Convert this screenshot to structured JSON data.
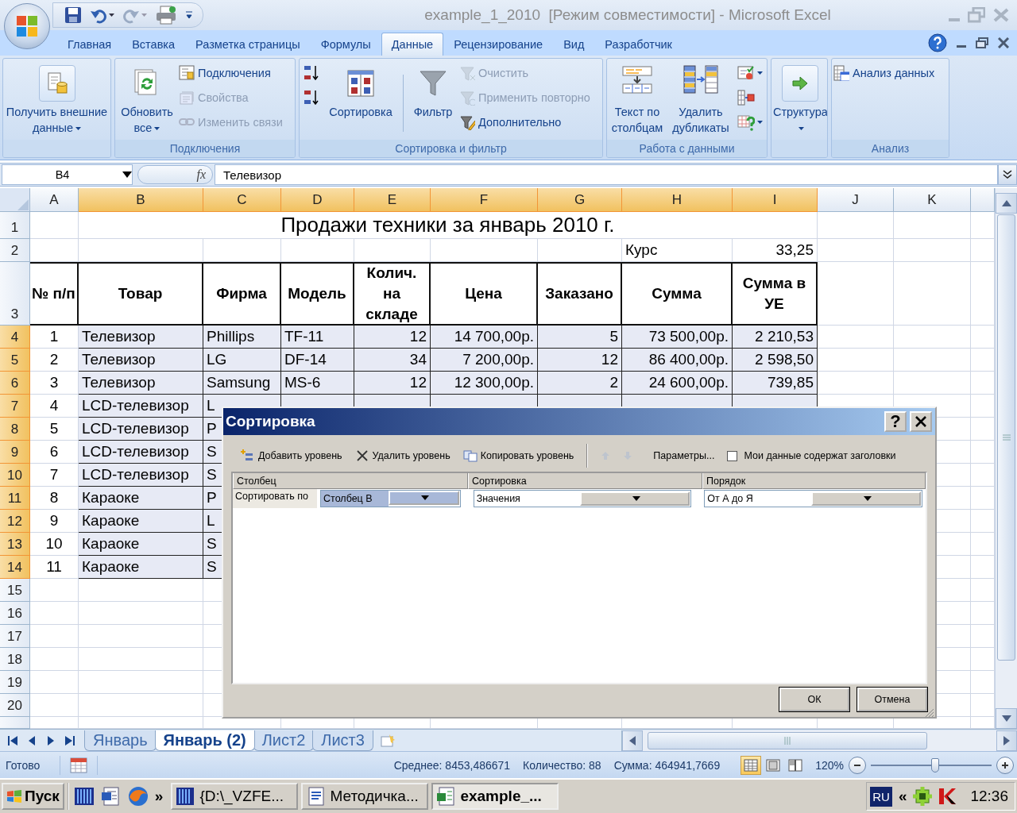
{
  "title_bar": {
    "title": "example_1_2010  [Режим совместимости] - Microsoft Excel"
  },
  "ribbon_tabs": [
    {
      "label": "Главная",
      "selected": false
    },
    {
      "label": "Вставка",
      "selected": false
    },
    {
      "label": "Разметка страницы",
      "selected": false
    },
    {
      "label": "Формулы",
      "selected": false
    },
    {
      "label": "Данные",
      "selected": true
    },
    {
      "label": "Рецензирование",
      "selected": false
    },
    {
      "label": "Вид",
      "selected": false
    },
    {
      "label": "Разработчик",
      "selected": false
    }
  ],
  "ribbon_groups": [
    {
      "items": [
        {
          "kind": "large",
          "label": "Получить внешние данные",
          "dropdown": true,
          "disabled": false
        }
      ]
    },
    {
      "label": "Подключения",
      "items": [
        {
          "kind": "large",
          "label": "Обновить все",
          "dropdown": true,
          "disabled": false
        },
        {
          "kind": "small",
          "label": "Подключения",
          "dropdown": false,
          "disabled": false
        },
        {
          "kind": "small",
          "label": "Свойства",
          "dropdown": false,
          "disabled": true
        },
        {
          "kind": "small",
          "label": "Изменить связи",
          "dropdown": false,
          "disabled": true
        }
      ]
    },
    {
      "label": "Сортировка и фильтр",
      "items": [
        {
          "kind": "icon",
          "dropdown": false,
          "disabled": false
        },
        {
          "kind": "icon",
          "dropdown": false,
          "disabled": false
        },
        {
          "kind": "large",
          "label": "Сортировка",
          "dropdown": false,
          "disabled": false
        },
        {
          "kind": "large",
          "label": "Фильтр",
          "dropdown": false,
          "disabled": false
        },
        {
          "kind": "small",
          "label": "Очистить",
          "dropdown": false,
          "disabled": true
        },
        {
          "kind": "small",
          "label": "Применить повторно",
          "dropdown": false,
          "disabled": true
        },
        {
          "kind": "small",
          "label": "Дополнительно",
          "dropdown": false,
          "disabled": false
        }
      ]
    },
    {
      "label": "Работа с данными",
      "items": [
        {
          "kind": "large",
          "label": "Текст по столбцам",
          "dropdown": false,
          "disabled": false
        },
        {
          "kind": "large",
          "label": "Удалить дубликаты",
          "dropdown": false,
          "disabled": false
        },
        {
          "kind": "icon",
          "dropdown": true,
          "disabled": false
        },
        {
          "kind": "icon",
          "dropdown": false,
          "disabled": false
        },
        {
          "kind": "icon",
          "dropdown": true,
          "disabled": false
        }
      ]
    },
    {
      "items": [
        {
          "kind": "large",
          "label": "Структура",
          "dropdown": true,
          "disabled": false
        }
      ]
    },
    {
      "label": "Анализ",
      "items": [
        {
          "kind": "small",
          "label": "Анализ данных",
          "dropdown": false,
          "disabled": false
        }
      ]
    }
  ],
  "formula_bar": {
    "name_box": "B4",
    "fx_label": "fx",
    "value": "Телевизор"
  },
  "sheet": {
    "columns": [
      {
        "label": "A",
        "selected": false
      },
      {
        "label": "B",
        "selected": true
      },
      {
        "label": "C",
        "selected": true
      },
      {
        "label": "D",
        "selected": true
      },
      {
        "label": "E",
        "selected": true
      },
      {
        "label": "F",
        "selected": true
      },
      {
        "label": "G",
        "selected": true
      },
      {
        "label": "H",
        "selected": true
      },
      {
        "label": "I",
        "selected": true
      },
      {
        "label": "J",
        "selected": false
      },
      {
        "label": "K",
        "selected": false
      }
    ],
    "row_headers": [
      {
        "label": "1",
        "selected": false
      },
      {
        "label": "2",
        "selected": false
      },
      {
        "label": "3",
        "selected": false
      },
      {
        "label": "4",
        "selected": true
      },
      {
        "label": "5",
        "selected": true
      },
      {
        "label": "6",
        "selected": true
      },
      {
        "label": "7",
        "selected": true
      },
      {
        "label": "8",
        "selected": true
      },
      {
        "label": "9",
        "selected": true
      },
      {
        "label": "10",
        "selected": true
      },
      {
        "label": "11",
        "selected": true
      },
      {
        "label": "12",
        "selected": true
      },
      {
        "label": "13",
        "selected": true
      },
      {
        "label": "14",
        "selected": true
      },
      {
        "label": "15",
        "selected": false
      },
      {
        "label": "16",
        "selected": false
      },
      {
        "label": "17",
        "selected": false
      },
      {
        "label": "18",
        "selected": false
      },
      {
        "label": "19",
        "selected": false
      },
      {
        "label": "20",
        "selected": false
      }
    ],
    "title": "Продажи техники за январь 2010 г.",
    "rate": {
      "label": "Курс",
      "value": "33,25"
    },
    "headers": [
      "№ п/п",
      "Товар",
      "Фирма",
      "Модель",
      "Колич. на складе",
      "Цена",
      "Заказано",
      "Сумма",
      "Сумма в УЕ"
    ],
    "records": [
      [
        "1",
        "Телевизор",
        "Phillips",
        "TF-11",
        "12",
        "14 700,00р.",
        "5",
        "73 500,00р.",
        "2 210,53"
      ],
      [
        "2",
        "Телевизор",
        "LG",
        "DF-14",
        "34",
        "7 200,00р.",
        "12",
        "86 400,00р.",
        "2 598,50"
      ],
      [
        "3",
        "Телевизор",
        "Samsung",
        "MS-6",
        "12",
        "12 300,00р.",
        "2",
        "24 600,00р.",
        "739,85"
      ],
      [
        "4",
        "LCD-телевизор",
        "L"
      ],
      [
        "5",
        "LCD-телевизор",
        "P"
      ],
      [
        "6",
        "LCD-телевизор",
        "S"
      ],
      [
        "7",
        "LCD-телевизор",
        "S"
      ],
      [
        "8",
        "Караоке",
        "P"
      ],
      [
        "9",
        "Караоке",
        "L"
      ],
      [
        "10",
        "Караоке",
        "S"
      ],
      [
        "11",
        "Караоке",
        "S"
      ]
    ]
  },
  "sheet_tabs": [
    {
      "label": "Январь",
      "selected": false
    },
    {
      "label": "Январь (2)",
      "selected": true
    },
    {
      "label": "Лист2",
      "selected": false
    },
    {
      "label": "Лист3",
      "selected": false
    }
  ],
  "status_bar": {
    "status": "Готово",
    "average": "Среднее: 8453,486671",
    "count": "Количество: 88",
    "sum": "Сумма: 464941,7669",
    "views": [
      {
        "selected": true
      },
      {
        "selected": false
      },
      {
        "selected": false
      }
    ],
    "zoom": "120%",
    "zoom_slider": {
      "level": 0.53
    }
  },
  "taskbar": {
    "start": "Пуск",
    "quick_launch_more": "»",
    "tasks": [
      {
        "label": "{D:\\_VZFE...",
        "selected": false
      },
      {
        "label": "Методичка...",
        "selected": false
      },
      {
        "label": "example_...",
        "selected": true
      }
    ],
    "language": "RU",
    "tray_expand": "«",
    "clock": "12:36"
  },
  "dialog": {
    "title": "Сортировка",
    "help": "?",
    "toolbar": [
      {
        "label": "Добавить уровень",
        "disabled": false
      },
      {
        "label": "Удалить уровень",
        "disabled": false
      },
      {
        "label": "Копировать уровень",
        "disabled": false
      }
    ],
    "move_buttons": [
      {
        "disabled": true
      },
      {
        "disabled": true
      }
    ],
    "options": "Параметры...",
    "headers_checkbox": {
      "label": "Мои данные содержат заголовки",
      "checked": false
    },
    "columns": [
      "Столбец",
      "Сортировка",
      "Порядок"
    ],
    "criteria": {
      "label": "Сортировать по",
      "column": {
        "value": "Столбец B",
        "selected": true
      },
      "sort_on": {
        "value": "Значения",
        "selected": false
      },
      "order": {
        "value": "От А до Я",
        "selected": false
      }
    },
    "buttons": [
      "ОК",
      "Отмена"
    ]
  }
}
